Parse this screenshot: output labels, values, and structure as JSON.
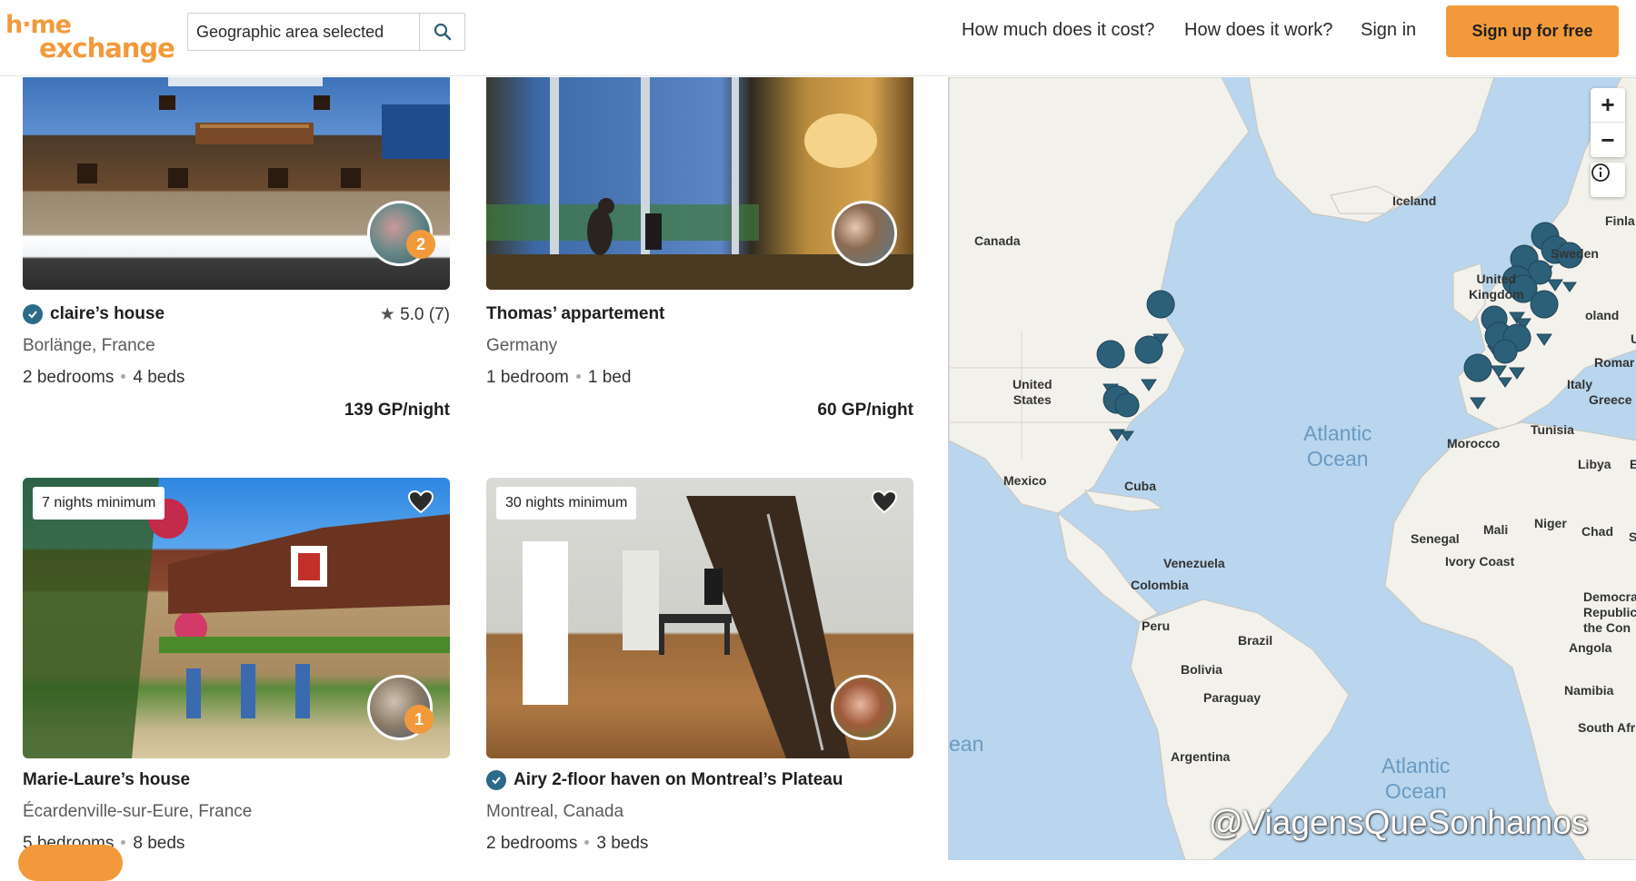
{
  "header": {
    "logo_line1": "h·me",
    "logo_line2": "exchange",
    "search_value": "Geographic area selected",
    "nav": {
      "cost": "How much does it cost?",
      "how": "How does it work?",
      "signin": "Sign in",
      "signup": "Sign up for free"
    }
  },
  "listings": [
    {
      "title": "claire’s house",
      "location": "Borlänge, France",
      "bedrooms": "2 bedrooms",
      "beds": "4 beds",
      "price": "139 GP/night",
      "rating": "5.0 (7)",
      "count_badge": "2"
    },
    {
      "title": "Thomas’ appartement",
      "location": "Germany",
      "bedrooms": "1 bedroom",
      "beds": "1 bed",
      "price": "60 GP/night"
    },
    {
      "title": "Marie-Laure’s house",
      "location": "Écardenville-sur-Eure, France",
      "bedrooms": "5 bedrooms",
      "beds": "8 beds",
      "min_nights": "7 nights minimum",
      "count_badge": "1"
    },
    {
      "title": "Airy 2-floor haven on Montreal’s Plateau",
      "location": "Montreal, Canada",
      "bedrooms": "2 bedrooms",
      "beds": "3 beds",
      "min_nights": "30 nights minimum"
    }
  ],
  "map": {
    "labels": {
      "iceland": "Iceland",
      "canada": "Canada",
      "finland": "Finla",
      "sweden": "Sweden",
      "uk": "United\nKingdom",
      "poland": "oland",
      "u": "U",
      "romania": "Romar",
      "italy": "Italy",
      "greece": "Greece",
      "us": "United\nStates",
      "tunisia": "Tunisia",
      "morocco": "Morocco",
      "libya": "Libya",
      "e": "E",
      "mexico": "Mexico",
      "cuba": "Cuba",
      "mali": "Mali",
      "niger": "Niger",
      "chad": "Chad",
      "s": "S",
      "senegal": "Senegal",
      "ivory": "Ivory Coast",
      "venezuela": "Venezuela",
      "colombia": "Colombia",
      "drc": "Democra\nRepublic\nthe Con",
      "peru": "Peru",
      "brazil": "Brazil",
      "angola": "Angola",
      "bolivia": "Bolivia",
      "paraguay": "Paraguay",
      "namibia": "Namibia",
      "southafrica": "South Afr",
      "argentina": "Argentina",
      "ocean_edge": "ean"
    },
    "ocean1": "Atlantic\nOcean",
    "ocean2": "Atlantic\nOcean",
    "zoom_in": "+",
    "zoom_out": "−",
    "marker_color": "#2c5f78",
    "land_color": "#f3f1ec",
    "water_color": "#b9d6ee"
  },
  "watermark": "@ViagensQueSonhamos",
  "colors": {
    "brand": "#f29a3b",
    "verified": "#2b6a88"
  }
}
